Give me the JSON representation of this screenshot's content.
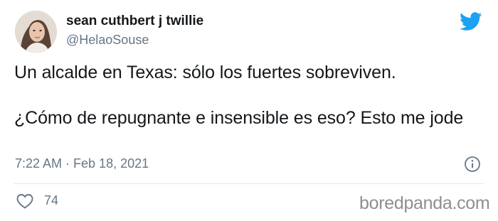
{
  "author": {
    "display_name": "sean cuthbert j twillie",
    "handle": "@HelaoSouse"
  },
  "tweet": {
    "line1": "Un alcalde en Texas: sólo los fuertes sobreviven.",
    "line2": "¿Cómo de repugnante e insensible es eso? Esto me jode"
  },
  "meta": {
    "timestamp": "7:22 AM · Feb 18, 2021",
    "like_count": "74"
  },
  "icons": {
    "brand": "twitter-bird-icon",
    "info": "info-icon",
    "like": "heart-icon"
  },
  "colors": {
    "twitter_blue": "#1da1f2",
    "secondary_text": "#657786",
    "primary_text": "#14171a"
  },
  "watermark": "boredpanda.com"
}
